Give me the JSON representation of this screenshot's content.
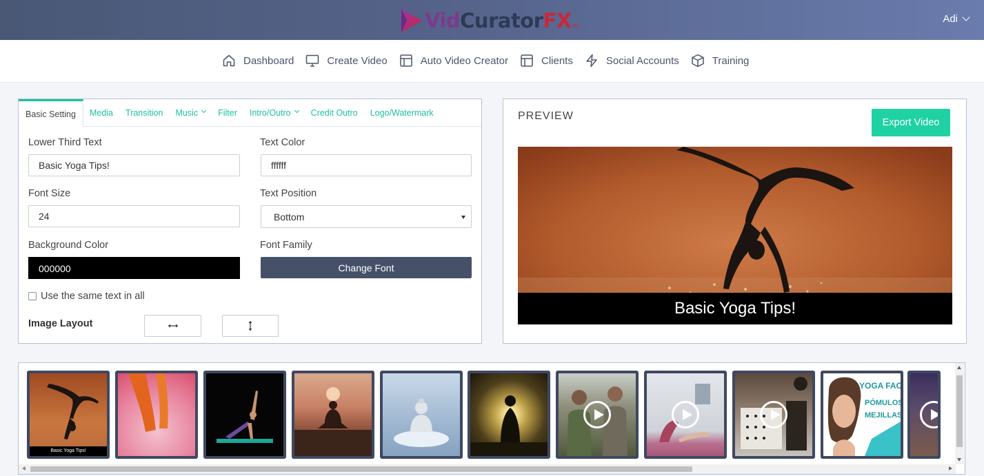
{
  "app": {
    "brand_vid": "Vid",
    "brand_curator": "Curator",
    "brand_fx": "FX",
    "brand_tm": "TM",
    "user_name": "Adi",
    "accent_color": "#1cc19d"
  },
  "nav": {
    "items": [
      {
        "label": "Dashboard",
        "icon": "home-icon"
      },
      {
        "label": "Create Video",
        "icon": "monitor-icon"
      },
      {
        "label": "Auto Video Creator",
        "icon": "layout-icon"
      },
      {
        "label": "Clients",
        "icon": "layout-icon"
      },
      {
        "label": "Social Accounts",
        "icon": "lightning-icon"
      },
      {
        "label": "Training",
        "icon": "box-icon"
      }
    ]
  },
  "settings": {
    "tabs": [
      {
        "label": "Basic Setting",
        "active": true
      },
      {
        "label": "Media"
      },
      {
        "label": "Transition"
      },
      {
        "label": "Music",
        "dropdown": true
      },
      {
        "label": "Filter"
      },
      {
        "label": "Intro/Outro",
        "dropdown": true
      },
      {
        "label": "Credit Outro"
      },
      {
        "label": "Logo/Watermark"
      }
    ],
    "lower_third_label": "Lower Third Text",
    "lower_third_value": "Basic Yoga Tips!",
    "text_color_label": "Text Color",
    "text_color_value": "ffffff",
    "font_size_label": "Font Size",
    "font_size_value": "24",
    "text_position_label": "Text Position",
    "text_position_value": "Bottom",
    "background_color_label": "Background Color",
    "background_color_value": "000000",
    "font_family_label": "Font Family",
    "change_font_label": "Change Font",
    "same_text_label": "Use the same text in all",
    "same_text_checked": false,
    "image_layout_label": "Image Layout"
  },
  "preview": {
    "title": "PREVIEW",
    "export_label": "Export Video",
    "caption": "Basic Yoga Tips!"
  },
  "thumbnails": {
    "first_caption": "Basic Yoga Tips!",
    "items": [
      {
        "kind": "image",
        "subject": "handstand yoga"
      },
      {
        "kind": "image",
        "subject": "petals walk"
      },
      {
        "kind": "image",
        "subject": "side plank"
      },
      {
        "kind": "image",
        "subject": "sunset meditation"
      },
      {
        "kind": "image",
        "subject": "buddha statue"
      },
      {
        "kind": "image",
        "subject": "silhouette sun"
      },
      {
        "kind": "video",
        "subject": "two men"
      },
      {
        "kind": "video",
        "subject": "yoga class"
      },
      {
        "kind": "video",
        "subject": "studio gear"
      },
      {
        "kind": "video",
        "subject": "yoga facial"
      },
      {
        "kind": "video",
        "subject": "cut-off clip"
      }
    ],
    "yoga_facial_line1": "YOGA FACIAL",
    "yoga_facial_line2": "PÓMULOS",
    "yoga_facial_line3": "MEJILLAS"
  }
}
